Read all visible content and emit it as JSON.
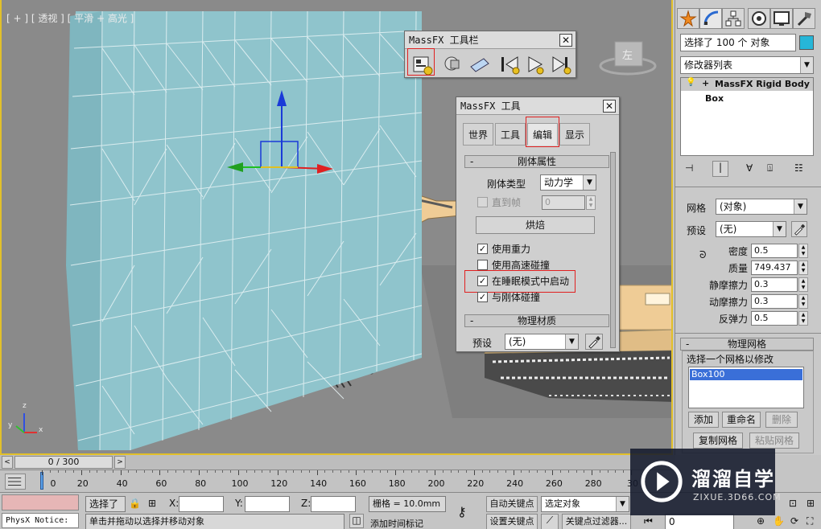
{
  "viewport": {
    "label": "[ + ] [ 透视 ] [ 平滑 + 高光 ]",
    "viewcube_face": "左",
    "axis_labels": {
      "z": "z",
      "y": "y",
      "x": "x"
    }
  },
  "massfx_toolbar": {
    "title": "MassFX 工具栏",
    "buttons": [
      "massfx-tools-icon",
      "rigid-body-icon",
      "cloth-icon",
      "reset-simulation-icon",
      "start-simulation-icon",
      "step-simulation-icon"
    ]
  },
  "massfx_tools": {
    "title": "MassFX 工具",
    "tabs": [
      "世界",
      "工具",
      "编辑",
      "显示"
    ],
    "active_tab": "编辑",
    "rigid_props": {
      "header": "刚体属性",
      "type_label": "刚体类型",
      "type_value": "动力学",
      "until_frame_label": "直到帧",
      "until_frame_value": "0",
      "bake_label": "烘焙",
      "use_gravity": "使用重力",
      "use_gravity_checked": true,
      "high_speed": "使用高速碰撞",
      "high_speed_checked": false,
      "sleep_start": "在睡眠模式中启动",
      "sleep_start_checked": true,
      "collide_rigid": "与刚体碰撞",
      "collide_rigid_checked": true
    },
    "phys_material": {
      "header": "物理材质",
      "preset_label": "预设",
      "preset_value": "(无)"
    }
  },
  "command_panel": {
    "selection_text": "选择了 100 个 对象",
    "modifier_list": "修改器列表",
    "stack": [
      "MassFX Rigid Body",
      "Box"
    ],
    "mesh_label": "网格",
    "mesh_value": "(对象)",
    "preset_label": "预设",
    "preset_value": "(无)",
    "density_label": "密度",
    "density_value": "0.5",
    "mass_label": "质量",
    "mass_value": "749.437",
    "static_friction_label": "静摩擦力",
    "static_friction_value": "0.3",
    "dynamic_friction_label": "动摩擦力",
    "dynamic_friction_value": "0.3",
    "bounce_label": "反弹力",
    "bounce_value": "0.5",
    "phys_mesh_header": "物理网格",
    "select_mesh_label": "选择一个网格以修改",
    "mesh_list": [
      "Box100"
    ],
    "add_btn": "添加",
    "rename_btn": "重命名",
    "delete_btn": "删除",
    "copy_btn": "复制网格",
    "paste_btn": "粘贴网格"
  },
  "timeline": {
    "frame_display": "0 / 300",
    "ticks": [
      "0",
      "20",
      "40",
      "60",
      "80",
      "100",
      "120",
      "140",
      "160",
      "180",
      "200",
      "220",
      "240",
      "260",
      "280",
      "30"
    ]
  },
  "status": {
    "physx_notice": "PhysX Notice:",
    "selected": "选择了",
    "x_label": "X:",
    "y_label": "Y:",
    "z_label": "Z:",
    "grid": "栅格 = 10.0mm",
    "auto_key": "自动关键点",
    "set_key": "设置关键点",
    "selected_object": "选定对象",
    "key_filter": "关键点过滤器...",
    "prompt": "单击并拖动以选择并移动对象",
    "add_time_tag": "添加时间标记",
    "frame_value": "0"
  },
  "watermark": {
    "brand": "溜溜自学",
    "url": "ZIXUE.3D66.COM"
  },
  "colors": {
    "wall": "#8fc4cc",
    "excavator": "#efcc96",
    "selection_red": "#e02020",
    "viewport_border": "#e2c02a",
    "watermark_bg": "#141a2c"
  }
}
